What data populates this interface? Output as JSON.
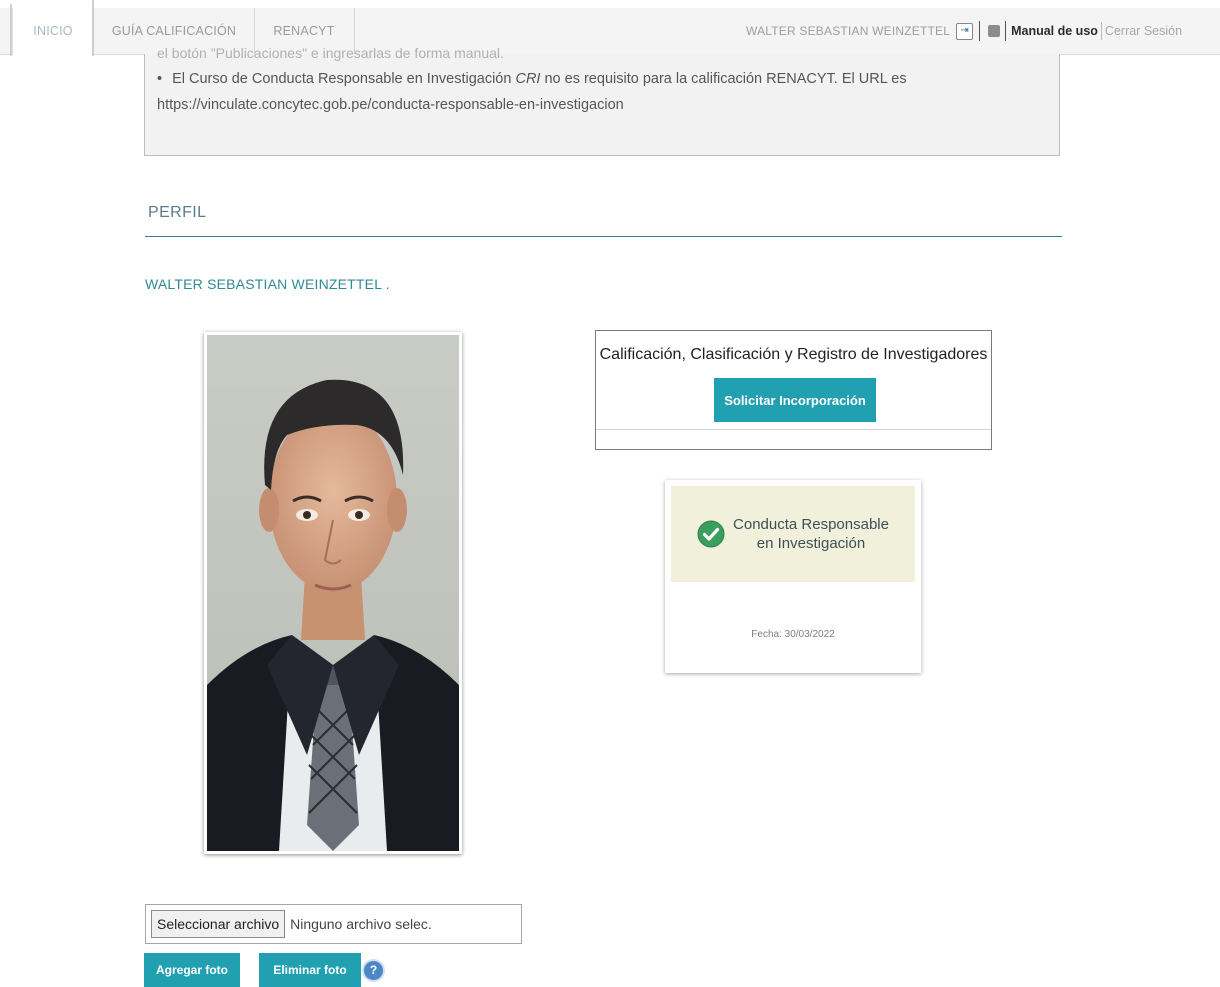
{
  "nav": {
    "tabs": [
      {
        "label": "INICIO"
      },
      {
        "label": "GUÍA CALIFICACIÓN"
      },
      {
        "label": "RENACYT"
      }
    ],
    "user_name": "WALTER SEBASTIAN WEINZETTEL",
    "manual_label": "Manual de uso",
    "logout_label": "Cerrar Sesión",
    "icons": [
      "exit-icon",
      "book-icon"
    ]
  },
  "notice": {
    "cut_text": "el botón \"Publicaciones\" e ingresarlas de forma manual.",
    "bullet_before": "El Curso de Conducta Responsable en Investigación ",
    "bullet_em": "CRI",
    "bullet_after": " no es requisito para la calificación RENACYT. El URL es",
    "url": "https://vinculate.concytec.gob.pe/conducta-responsable-en-investigacion"
  },
  "profile": {
    "section_title": "PERFIL",
    "person_name": "WALTER SEBASTIAN WEINZETTEL ."
  },
  "registry": {
    "title": "Calificación, Clasificación y Registro de Investigadores",
    "button_label": "Solicitar Incorporación"
  },
  "cri_badge": {
    "line1": "Conducta Responsable",
    "line2": "en Investigación",
    "date": "Fecha: 30/03/2022",
    "icon": "check-circle-icon"
  },
  "upload": {
    "file_button_label": "Seleccionar archivo",
    "file_status": "Ninguno archivo selec.",
    "add_label": "Agregar foto",
    "delete_label": "Eliminar foto",
    "help_symbol": "?"
  },
  "colors": {
    "accent_teal": "#21a0b1",
    "rule_teal": "#3f7e8f",
    "name_teal": "#2f8a93",
    "badge_bg": "#f1f0da",
    "check_green": "#3a9e5e"
  }
}
